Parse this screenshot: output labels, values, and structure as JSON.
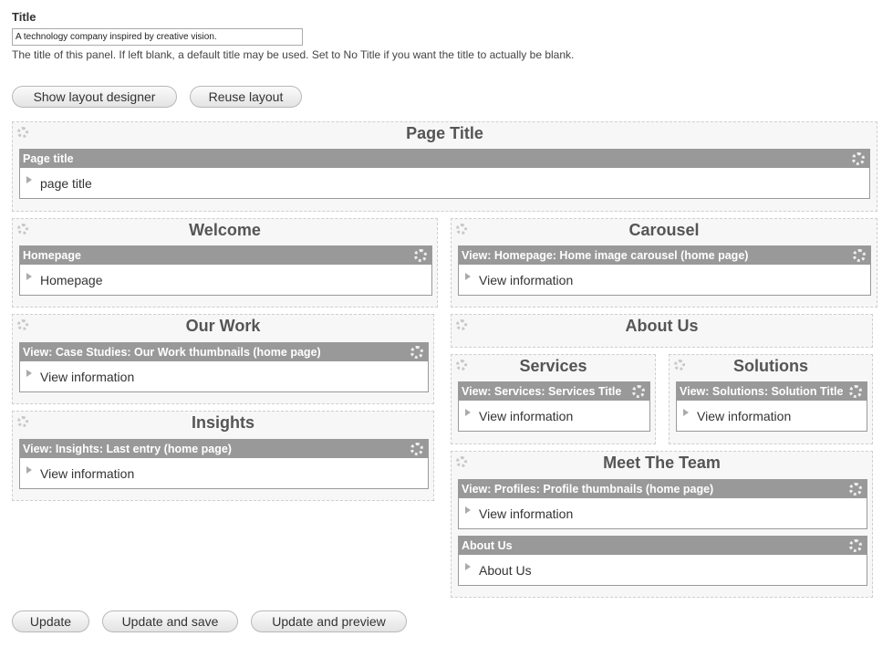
{
  "title_field": {
    "label": "Title",
    "value": "A technology company inspired by creative vision.",
    "help": "The title of this panel. If left blank, a default title may be used. Set to No Title if you want the title to actually be blank."
  },
  "top_buttons": {
    "show_designer": "Show layout designer",
    "reuse_layout": "Reuse layout"
  },
  "regions": {
    "page_title": {
      "title": "Page Title",
      "pane_head": "Page title",
      "pane_body": "page title"
    },
    "welcome": {
      "title": "Welcome",
      "pane_head": "Homepage",
      "pane_body": "Homepage"
    },
    "carousel": {
      "title": "Carousel",
      "pane_head": "View: Homepage: Home image carousel (home page)",
      "pane_body": "View information"
    },
    "our_work": {
      "title": "Our Work",
      "pane_head": "View: Case Studies: Our Work thumbnails (home page)",
      "pane_body": "View information"
    },
    "about_us": {
      "title": "About Us"
    },
    "services": {
      "title": "Services",
      "pane_head": "View: Services: Services Title",
      "pane_body": "View information"
    },
    "solutions": {
      "title": "Solutions",
      "pane_head": "View: Solutions: Solution Title",
      "pane_body": "View information"
    },
    "insights": {
      "title": "Insights",
      "pane_head": "View: Insights: Last entry (home page)",
      "pane_body": "View information"
    },
    "meet_team": {
      "title": "Meet The Team",
      "pane1_head": "View: Profiles: Profile thumbnails (home page)",
      "pane1_body": "View information",
      "pane2_head": "About Us",
      "pane2_body": "About Us"
    }
  },
  "bottom_buttons": {
    "update": "Update",
    "update_save": "Update and save",
    "update_preview": "Update and preview"
  }
}
